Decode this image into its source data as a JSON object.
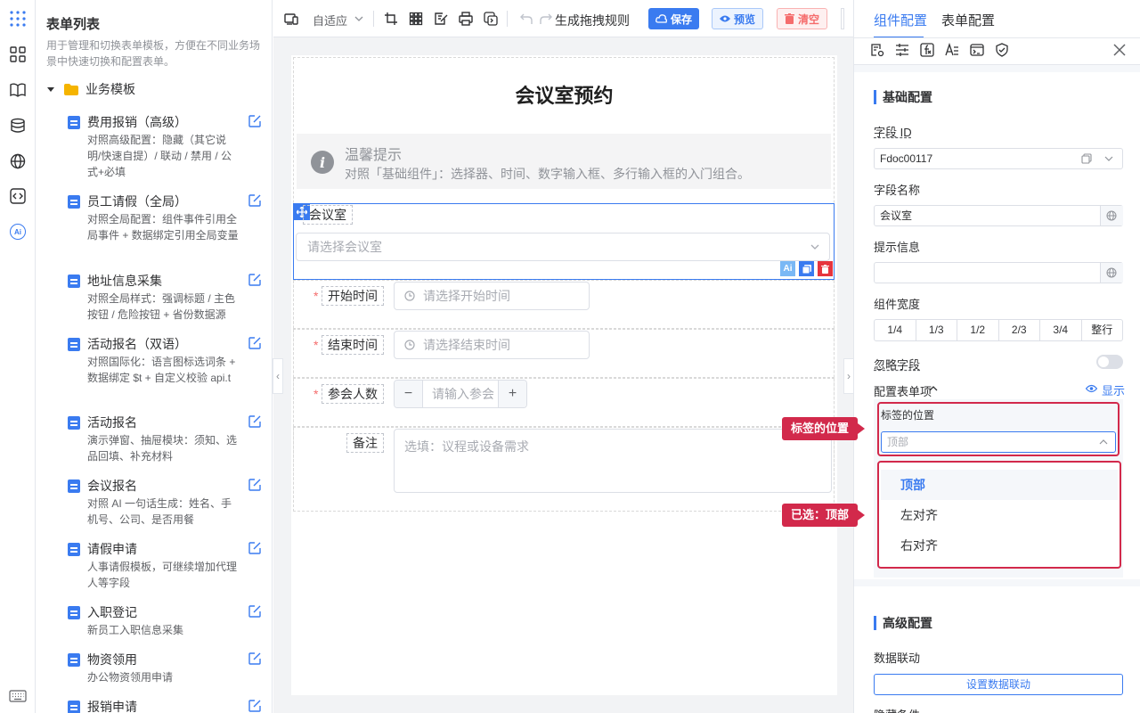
{
  "rail": {
    "items": [
      "apps-icon",
      "grid-icon",
      "book-icon",
      "database-icon",
      "globe-icon",
      "code-icon",
      "ai-icon",
      "keyboard-icon"
    ],
    "ai_label": "Ai"
  },
  "form_list": {
    "title": "表单列表",
    "description": "用于管理和切换表单模板，方便在不同业务场景中快速切换和配置表单。",
    "folder": "业务模板",
    "templates": [
      {
        "name": "费用报销（高级）",
        "desc": "对照高级配置：隐藏（其它说明/快速自提）/ 联动 / 禁用 / 公式+必填"
      },
      {
        "name": "员工请假（全局）",
        "desc": "对照全局配置：组件事件引用全局事件 + 数据绑定引用全局变量"
      },
      {
        "name": "地址信息采集",
        "desc": "对照全局样式：强调标题 / 主色按钮 / 危险按钮 + 省份数据源"
      },
      {
        "name": "活动报名（双语）",
        "desc": "对照国际化：语言图标选词条 + 数据绑定 $t + 自定义校验 api.t"
      },
      {
        "name": "活动报名",
        "desc": "演示弹窗、抽屉模块：须知、选品回填、补充材料"
      },
      {
        "name": "会议报名",
        "desc": "对照 AI 一句话生成：姓名、手机号、公司、是否用餐"
      },
      {
        "name": "请假申请",
        "desc": "人事请假模板，可继续增加代理人等字段"
      },
      {
        "name": "入职登记",
        "desc": "新员工入职信息采集"
      },
      {
        "name": "物资领用",
        "desc": "办公物资领用申请"
      },
      {
        "name": "报销申请",
        "desc": ""
      }
    ]
  },
  "toolbar": {
    "layout_mode": "自适应",
    "generate_rules": "生成拖拽规则",
    "save": "保存",
    "preview": "预览",
    "clear": "清空"
  },
  "form": {
    "title": "会议室预约",
    "tip_title": "温馨提示",
    "tip_text": "对照「基础组件」：选择器、时间、数字输入框、多行输入框的入门组合。",
    "room_label": "会议室",
    "room_placeholder": "请选择会议室",
    "start_label": "开始时间",
    "start_placeholder": "请选择开始时间",
    "end_label": "结束时间",
    "end_placeholder": "请选择结束时间",
    "count_label": "参会人数",
    "count_placeholder": "请输入参会",
    "count_minus": "−",
    "count_plus": "+",
    "remark_label": "备注",
    "remark_placeholder": "选填：议程或设备需求",
    "required_mark": "*",
    "ai_badge": "Ai"
  },
  "config": {
    "tab_component": "组件配置",
    "tab_form": "表单配置",
    "basic_title": "基础配置",
    "field_id_label": "字段 ID",
    "field_id_value": "Fdoc00117",
    "field_name_label": "字段名称",
    "field_name_value": "会议室",
    "hint_label": "提示信息",
    "hint_value": "",
    "width_label": "组件宽度",
    "width_options": [
      "1/4",
      "1/3",
      "1/2",
      "2/3",
      "3/4",
      "整行"
    ],
    "ignore_label": "忽略字段",
    "form_items_label": "配置表单项",
    "show_label": "显示",
    "label_pos_label": "标签的位置",
    "label_pos_value": "顶部",
    "dropdown_options": [
      "顶部",
      "左对齐",
      "右对齐"
    ],
    "callout_label_pos": "标签的位置",
    "callout_selected": "已选：顶部",
    "advanced_title": "高级配置",
    "linkage_label": "数据联动",
    "linkage_button": "设置数据联动",
    "hidden_cond_label": "隐藏条件"
  },
  "colors": {
    "primary": "#3a7bf0",
    "danger": "#f56c6c",
    "highlight": "#d2294b"
  }
}
